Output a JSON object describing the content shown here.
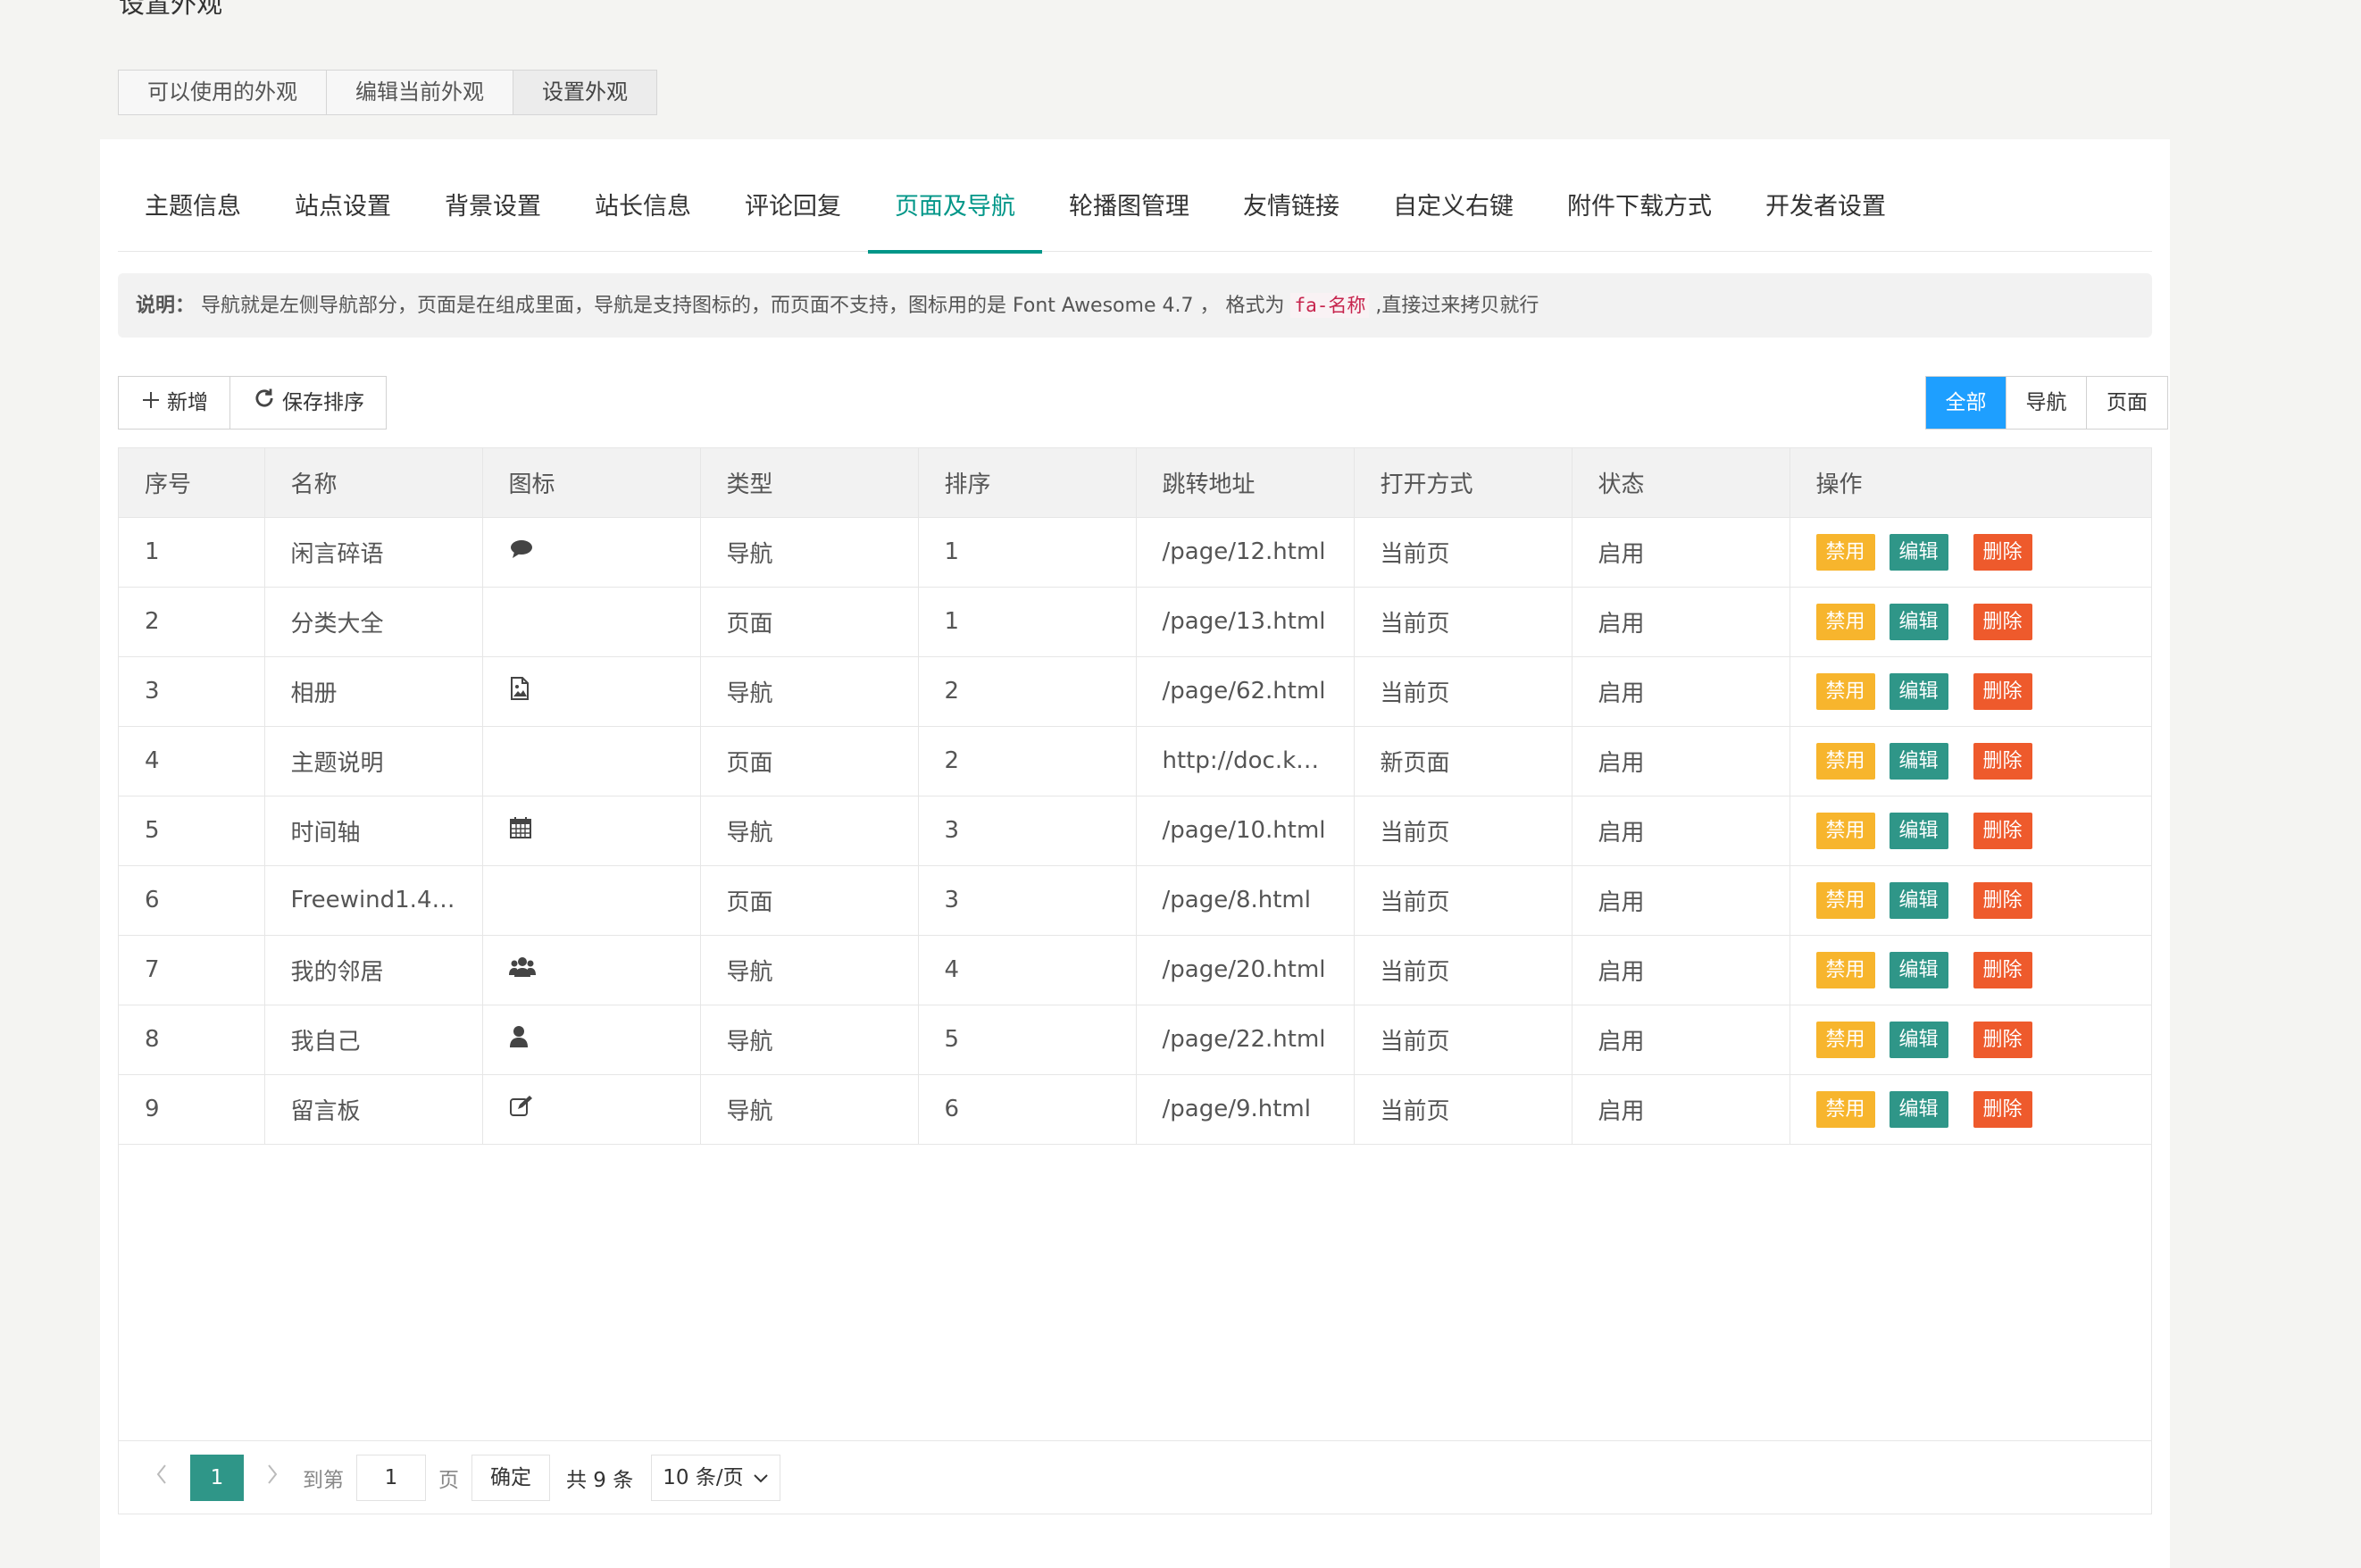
{
  "page_title": "设置外观",
  "top_tabs": [
    {
      "label": "可以使用的外观",
      "active": false
    },
    {
      "label": "编辑当前外观",
      "active": false
    },
    {
      "label": "设置外观",
      "active": true
    }
  ],
  "nav_tabs": [
    {
      "label": "主题信息",
      "active": false
    },
    {
      "label": "站点设置",
      "active": false
    },
    {
      "label": "背景设置",
      "active": false
    },
    {
      "label": "站长信息",
      "active": false
    },
    {
      "label": "评论回复",
      "active": false
    },
    {
      "label": "页面及导航",
      "active": true
    },
    {
      "label": "轮播图管理",
      "active": false
    },
    {
      "label": "友情链接",
      "active": false
    },
    {
      "label": "自定义右键",
      "active": false
    },
    {
      "label": "附件下载方式",
      "active": false
    },
    {
      "label": "开发者设置",
      "active": false
    }
  ],
  "notice": {
    "label": "说明：",
    "text": "导航就是左侧导航部分，页面是在组成里面，导航是支持图标的，而页面不支持，图标用的是 Font Awesome 4.7 ， 格式为",
    "code": "fa-名称",
    "suffix": ",直接过来拷贝就行"
  },
  "toolbar": {
    "add_label": "新增",
    "save_sort_label": "保存排序"
  },
  "filter": {
    "all": "全部",
    "nav": "导航",
    "page": "页面"
  },
  "table": {
    "columns": [
      "序号",
      "名称",
      "图标",
      "类型",
      "排序",
      "跳转地址",
      "打开方式",
      "状态",
      "操作"
    ],
    "actions": {
      "disable": "禁用",
      "edit": "编辑",
      "delete": "删除"
    },
    "rows": [
      {
        "no": "1",
        "name": "闲言碎语",
        "icon": "comment-icon",
        "type": "导航",
        "sort": "1",
        "url": "/page/12.html",
        "open": "当前页",
        "status": "启用"
      },
      {
        "no": "2",
        "name": "分类大全",
        "icon": "",
        "type": "页面",
        "sort": "1",
        "url": "/page/13.html",
        "open": "当前页",
        "status": "启用"
      },
      {
        "no": "3",
        "name": "相册",
        "icon": "image-file-icon",
        "type": "导航",
        "sort": "2",
        "url": "/page/62.html",
        "open": "当前页",
        "status": "启用"
      },
      {
        "no": "4",
        "name": "主题说明",
        "icon": "",
        "type": "页面",
        "sort": "2",
        "url": "http://doc.k…",
        "open": "新页面",
        "status": "启用"
      },
      {
        "no": "5",
        "name": "时间轴",
        "icon": "calendar-icon",
        "type": "导航",
        "sort": "3",
        "url": "/page/10.html",
        "open": "当前页",
        "status": "启用"
      },
      {
        "no": "6",
        "name": "Freewind1.4…",
        "icon": "",
        "type": "页面",
        "sort": "3",
        "url": "/page/8.html",
        "open": "当前页",
        "status": "启用"
      },
      {
        "no": "7",
        "name": "我的邻居",
        "icon": "users-icon",
        "type": "导航",
        "sort": "4",
        "url": "/page/20.html",
        "open": "当前页",
        "status": "启用"
      },
      {
        "no": "8",
        "name": "我自己",
        "icon": "user-icon",
        "type": "导航",
        "sort": "5",
        "url": "/page/22.html",
        "open": "当前页",
        "status": "启用"
      },
      {
        "no": "9",
        "name": "留言板",
        "icon": "edit-icon",
        "type": "导航",
        "sort": "6",
        "url": "/page/9.html",
        "open": "当前页",
        "status": "启用"
      }
    ]
  },
  "pager": {
    "current": "1",
    "goto_label": "到第",
    "goto_value": "1",
    "page_unit": "页",
    "confirm": "确定",
    "total": "共 9 条",
    "page_size": "10 条/页"
  }
}
